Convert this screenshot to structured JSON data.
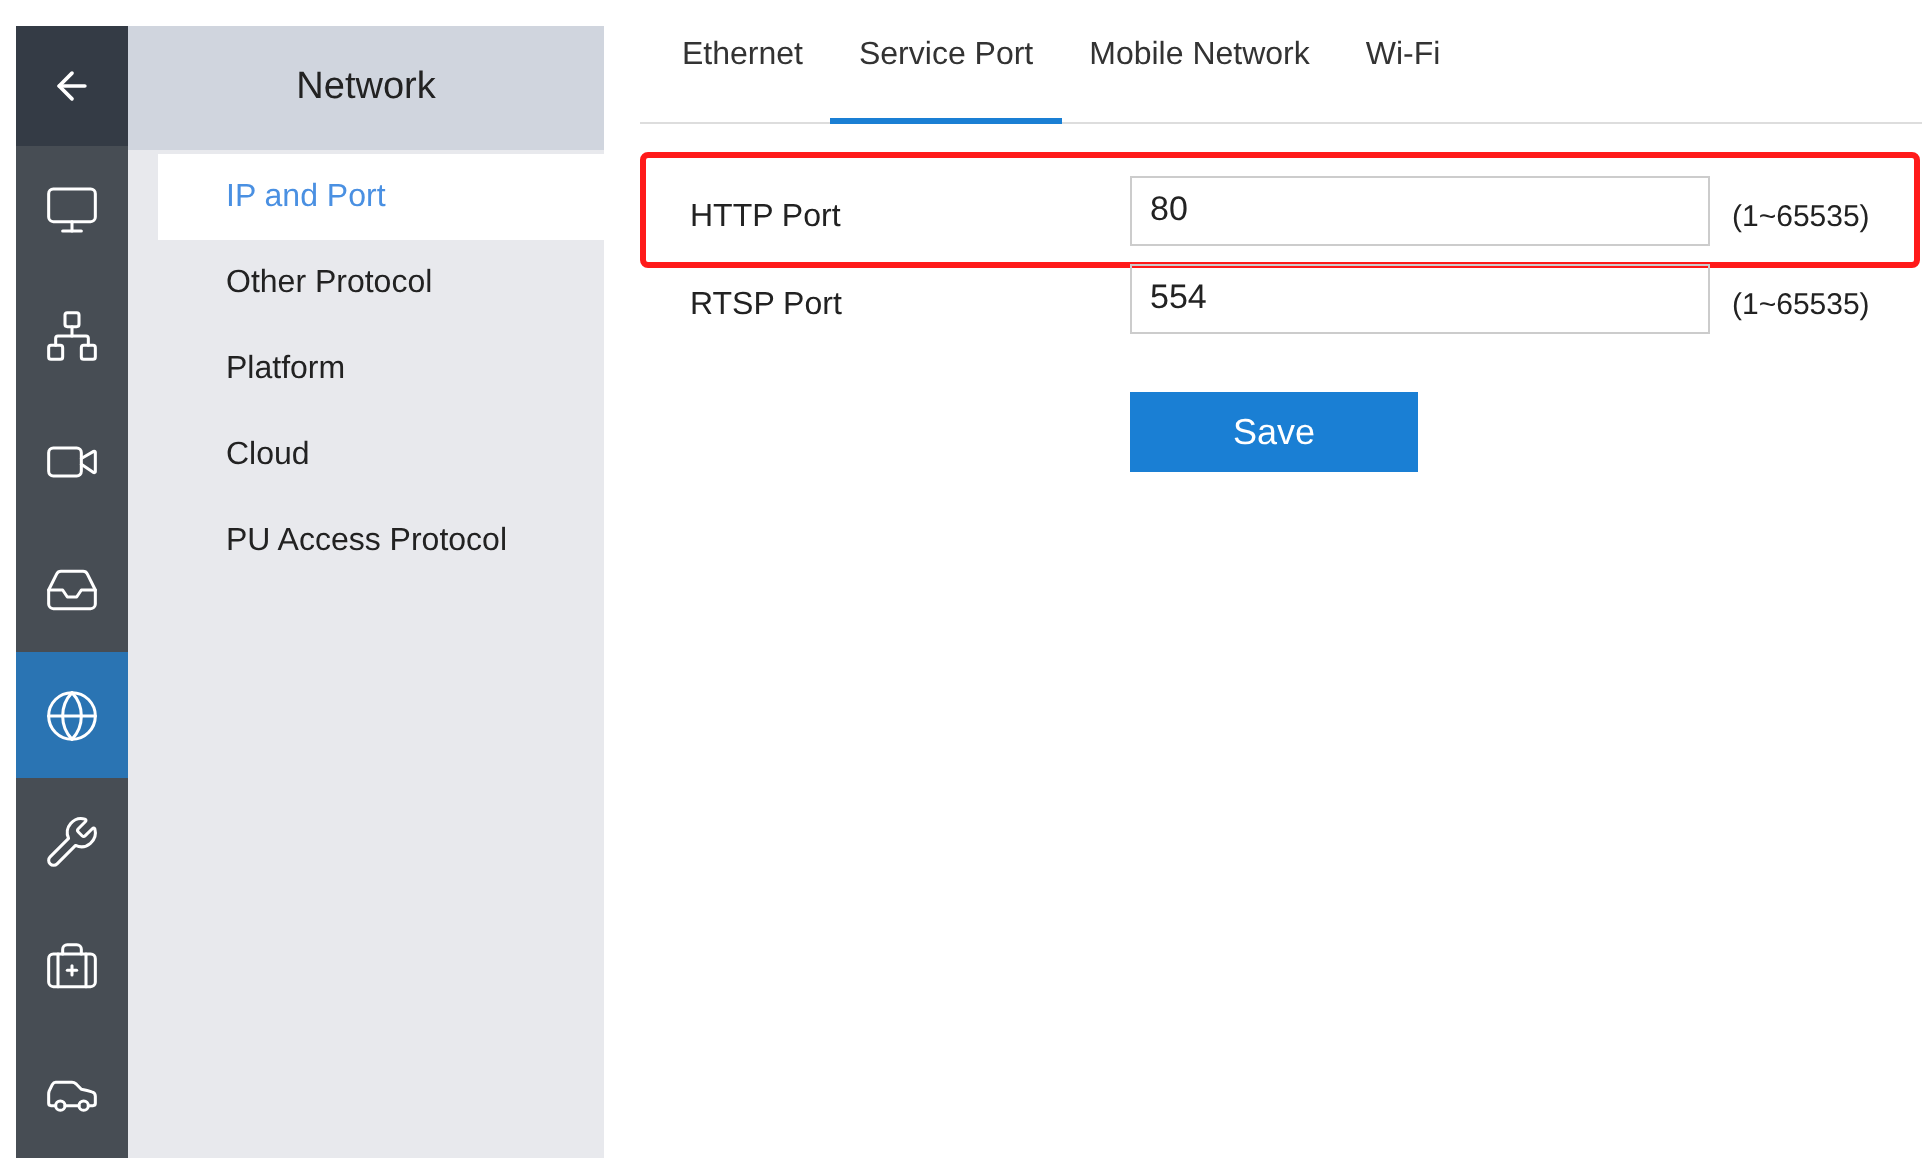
{
  "rail": {
    "items": [
      {
        "kind": "monitor",
        "selected": false
      },
      {
        "kind": "topology",
        "selected": false
      },
      {
        "kind": "camera",
        "selected": false
      },
      {
        "kind": "tray",
        "selected": false
      },
      {
        "kind": "network",
        "selected": true
      },
      {
        "kind": "tools",
        "selected": false
      },
      {
        "kind": "maintenance",
        "selected": false
      },
      {
        "kind": "vehicle",
        "selected": false
      }
    ]
  },
  "sidebar": {
    "title": "Network",
    "items": [
      {
        "label": "IP and Port",
        "selected": true
      },
      {
        "label": "Other Protocol",
        "selected": false
      },
      {
        "label": "Platform",
        "selected": false
      },
      {
        "label": "Cloud",
        "selected": false
      },
      {
        "label": "PU Access Protocol",
        "selected": false
      }
    ]
  },
  "tabs": [
    {
      "label": "Ethernet",
      "selected": false
    },
    {
      "label": "Service Port",
      "selected": true
    },
    {
      "label": "Mobile Network",
      "selected": false
    },
    {
      "label": "Wi-Fi",
      "selected": false
    }
  ],
  "form": {
    "rows": [
      {
        "label": "HTTP Port",
        "value": "80",
        "range": "(1~65535)",
        "highlighted": true
      },
      {
        "label": "RTSP Port",
        "value": "554",
        "range": "(1~65535)",
        "highlighted": false
      }
    ],
    "save_button": "Save"
  }
}
